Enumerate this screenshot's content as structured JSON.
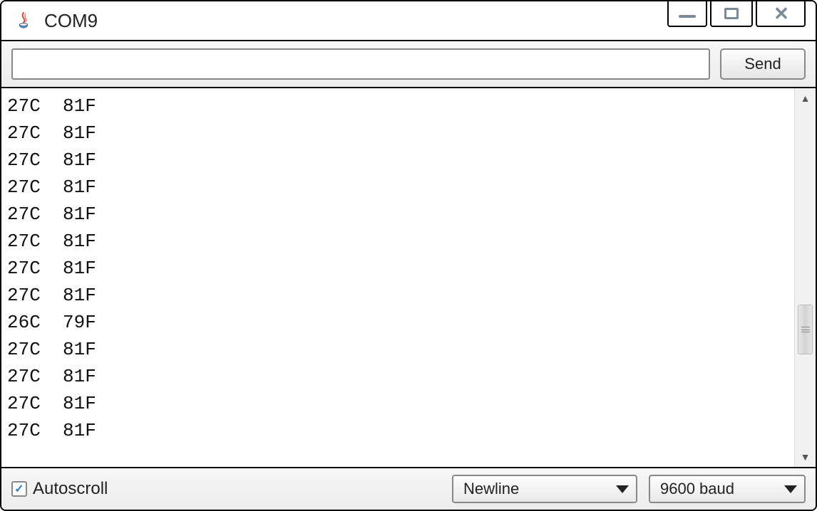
{
  "window": {
    "title": "COM9"
  },
  "toolbar": {
    "input_value": "",
    "send_label": "Send"
  },
  "output": {
    "lines": [
      "27C  81F",
      "27C  81F",
      "27C  81F",
      "27C  81F",
      "27C  81F",
      "27C  81F",
      "27C  81F",
      "27C  81F",
      "26C  79F",
      "27C  81F",
      "27C  81F",
      "27C  81F",
      "27C  81F"
    ]
  },
  "footer": {
    "autoscroll_label": "Autoscroll",
    "autoscroll_checked": true,
    "line_ending": "Newline",
    "baud": "9600 baud"
  }
}
